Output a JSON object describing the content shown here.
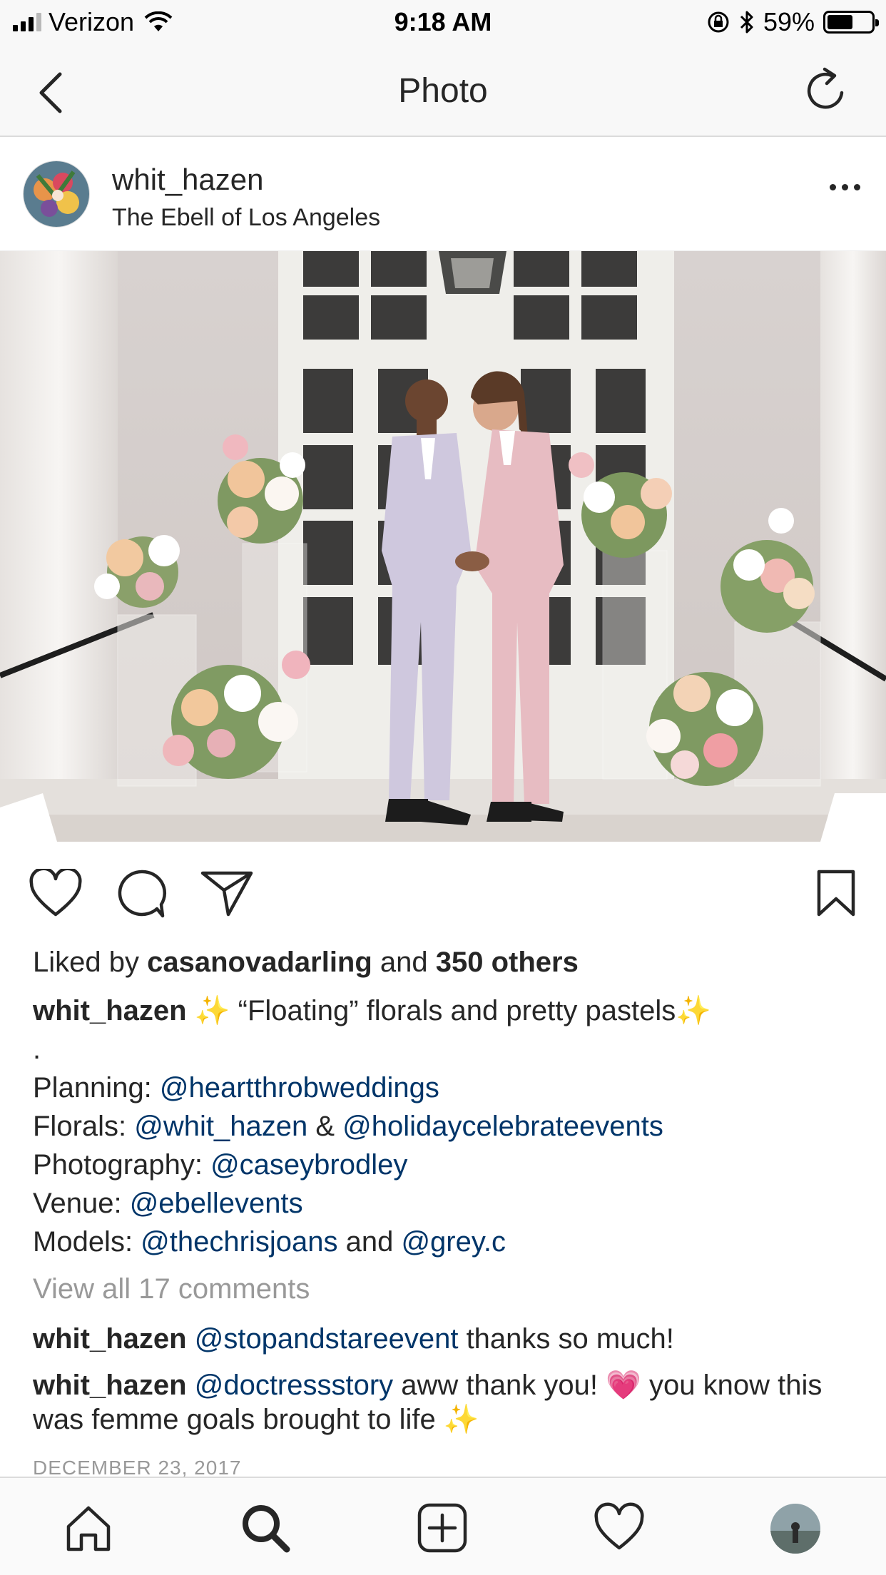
{
  "status_bar": {
    "carrier": "Verizon",
    "time": "9:18 AM",
    "battery_percent": "59%",
    "battery_level": 0.59,
    "icons": [
      "signal-icon",
      "wifi-icon",
      "rotation-lock-icon",
      "bluetooth-icon",
      "battery-icon"
    ]
  },
  "nav": {
    "title": "Photo",
    "back_icon": "chevron-left-icon",
    "refresh_icon": "refresh-icon"
  },
  "post": {
    "username": "whit_hazen",
    "location": "The Ebell of Los Angeles",
    "more_icon": "more-horizontal-icon",
    "likes": {
      "prefix": "Liked by ",
      "user": "casanovadarling",
      "middle": " and ",
      "count": "350 others"
    },
    "caption": {
      "username": "whit_hazen",
      "headline": " ✨ “Floating” florals and pretty pastels✨",
      "dot": ".",
      "planning_label": "Planning: ",
      "planning_mention": "@heartthrobweddings",
      "florals_label": "Florals: ",
      "florals_mention1": "@whit_hazen",
      "florals_amp": " & ",
      "florals_mention2": "@holidaycelebrateevents",
      "photo_label": "Photography: ",
      "photo_mention": "@caseybrodley",
      "venue_label": "Venue: ",
      "venue_mention": "@ebellevents",
      "models_label": "Models: ",
      "models_mention1": "@thechrisjoans",
      "models_and": " and ",
      "models_mention2": "@grey.c"
    },
    "view_all": "View all 17 comments",
    "comments": [
      {
        "username": "whit_hazen",
        "mention": "@stopandstareevent",
        "text": " thanks so much!"
      },
      {
        "username": "whit_hazen",
        "mention": "@doctressstory",
        "text": " aww thank you! 💗 you know this was femme goals brought to life ✨"
      }
    ],
    "date": "DECEMBER 23, 2017"
  },
  "actions": {
    "icons": [
      "heart-icon",
      "comment-icon",
      "share-icon",
      "bookmark-icon"
    ]
  },
  "tab_bar": {
    "items": [
      "home-icon",
      "search-icon",
      "add-post-icon",
      "activity-heart-icon",
      "profile-avatar"
    ]
  }
}
